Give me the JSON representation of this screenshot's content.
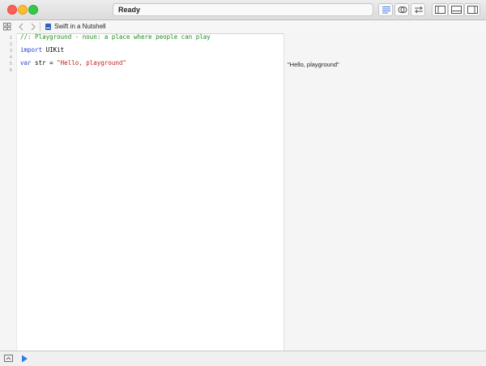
{
  "window": {
    "status": "Ready"
  },
  "toolbar": {
    "buttons": [
      {
        "name": "standard-editor-button",
        "icon": "lines-icon"
      },
      {
        "name": "assistant-editor-button",
        "icon": "venn-icon"
      },
      {
        "name": "version-editor-button",
        "icon": "arrows-icon"
      },
      {
        "name": "navigator-toggle-button",
        "icon": "left-panel-icon"
      },
      {
        "name": "debug-area-toggle-button",
        "icon": "bottom-panel-icon"
      },
      {
        "name": "utilities-toggle-button",
        "icon": "right-panel-icon"
      }
    ]
  },
  "jumpbar": {
    "file_name": "Swift in a Nutshell"
  },
  "editor": {
    "line_numbers": [
      "1",
      "2",
      "3",
      "4",
      "5",
      "6"
    ],
    "lines": [
      {
        "parts": [
          {
            "t": "//: Playground - noun: a place where people can play",
            "c": "comment"
          }
        ]
      },
      {
        "parts": []
      },
      {
        "parts": [
          {
            "t": "import",
            "c": "kw2"
          },
          {
            "t": " UIKit",
            "c": "plain"
          }
        ]
      },
      {
        "parts": []
      },
      {
        "parts": [
          {
            "t": "var",
            "c": "kw2"
          },
          {
            "t": " str = ",
            "c": "plain"
          },
          {
            "t": "\"Hello, playground\"",
            "c": "str"
          }
        ]
      },
      {
        "parts": []
      }
    ]
  },
  "results": {
    "line_5": "\"Hello, playground\""
  },
  "colors": {
    "comment": "#1f8d1f",
    "keyword": "#2a3fd0",
    "string": "#c41a16",
    "run_button": "#2f7ce0"
  }
}
